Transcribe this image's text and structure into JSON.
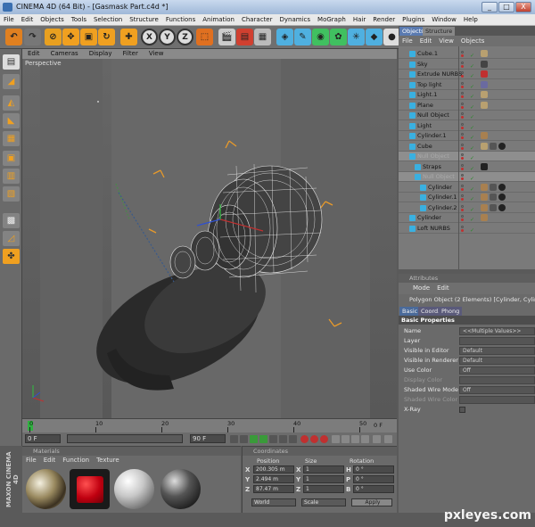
{
  "window": {
    "title": "CINEMA 4D (64 Bit) - [Gasmask Part.c4d *]",
    "min": "_",
    "max": "□",
    "close": "X"
  },
  "menubar": [
    "File",
    "Edit",
    "Objects",
    "Tools",
    "Selection",
    "Structure",
    "Functions",
    "Animation",
    "Character",
    "Dynamics",
    "MoGraph",
    "Hair",
    "Render",
    "Plugins",
    "Window",
    "Help"
  ],
  "toolbar": {
    "axis_x": "X",
    "axis_y": "Y",
    "axis_z": "Z"
  },
  "viewport": {
    "menu": [
      "Edit",
      "Cameras",
      "Display",
      "Filter",
      "View"
    ],
    "label": "Perspective"
  },
  "timeline": {
    "ticks": [
      "0",
      "10",
      "20",
      "30",
      "40",
      "50"
    ],
    "end_marker": "0 F",
    "start_field": "0 F",
    "end_field": "90 F"
  },
  "materials": {
    "title": "Materials",
    "menu": [
      "File",
      "Edit",
      "Function",
      "Texture"
    ]
  },
  "coordinates": {
    "title": "Coordinates",
    "headers": [
      "Position",
      "Size",
      "Rotation"
    ],
    "rows": [
      {
        "axis": "X",
        "pos": "200.305 m",
        "size": "1",
        "rot_axis": "H",
        "rot": "0 °"
      },
      {
        "axis": "Y",
        "pos": "2.494 m",
        "size": "1",
        "rot_axis": "P",
        "rot": "0 °"
      },
      {
        "axis": "Z",
        "pos": "87.47 m",
        "size": "1",
        "rot_axis": "B",
        "rot": "0 °"
      }
    ],
    "mode1": "World",
    "mode2": "Scale",
    "apply": "Apply"
  },
  "objects": {
    "tabs": [
      "Objects",
      "Structure"
    ],
    "menu": [
      "File",
      "Edit",
      "View",
      "Objects"
    ],
    "items": [
      {
        "name": "Cube.1",
        "indent": 0,
        "sel": false
      },
      {
        "name": "Sky",
        "indent": 0,
        "sel": false
      },
      {
        "name": "Extrude NURBS",
        "indent": 0,
        "sel": false
      },
      {
        "name": "Top light",
        "indent": 0,
        "sel": false
      },
      {
        "name": "Light.1",
        "indent": 0,
        "sel": false
      },
      {
        "name": "Plane",
        "indent": 0,
        "sel": false
      },
      {
        "name": "Null Object",
        "indent": 0,
        "sel": false
      },
      {
        "name": "Light",
        "indent": 0,
        "sel": false
      },
      {
        "name": "Cylinder.1",
        "indent": 0,
        "sel": false
      },
      {
        "name": "Cube",
        "indent": 0,
        "sel": false
      },
      {
        "name": "Null Object",
        "indent": 0,
        "sel": true
      },
      {
        "name": "Straps",
        "indent": 1,
        "sel": false
      },
      {
        "name": "Null Object",
        "indent": 1,
        "sel": true
      },
      {
        "name": "Cylinder",
        "indent": 2,
        "sel": false
      },
      {
        "name": "Cylinder.1",
        "indent": 2,
        "sel": false
      },
      {
        "name": "Cylinder.2",
        "indent": 2,
        "sel": false
      },
      {
        "name": "Cylinder",
        "indent": 0,
        "sel": false
      },
      {
        "name": "Loft NURBS",
        "indent": 0,
        "sel": false
      }
    ]
  },
  "attributes": {
    "title": "Attributes",
    "menu": [
      "Mode",
      "Edit"
    ],
    "info": "Polygon Object (2 Elements) [Cylinder, Cylinder.1]",
    "tabs": [
      "Basic",
      "Coord.",
      "Phong"
    ],
    "section": "Basic Properties",
    "rows": [
      {
        "label": "Name",
        "value": "<<Multiple Values>>",
        "dim": false
      },
      {
        "label": "Layer",
        "value": "",
        "dim": false
      },
      {
        "label": "Visible in Editor",
        "value": "Default",
        "dim": false
      },
      {
        "label": "Visible in Renderer",
        "value": "Default",
        "dim": false
      },
      {
        "label": "Use Color",
        "value": "Off",
        "dim": false
      },
      {
        "label": "Display Color",
        "value": "",
        "dim": true
      },
      {
        "label": "Shaded Wire Mode",
        "value": "Off",
        "dim": false
      },
      {
        "label": "Shaded Wire Color",
        "value": "",
        "dim": true
      },
      {
        "label": "X-Ray",
        "value": "",
        "dim": false
      }
    ]
  },
  "branding": {
    "maxon": "MAXON CINEMA 4D",
    "watermark": "pxleyes.com"
  }
}
